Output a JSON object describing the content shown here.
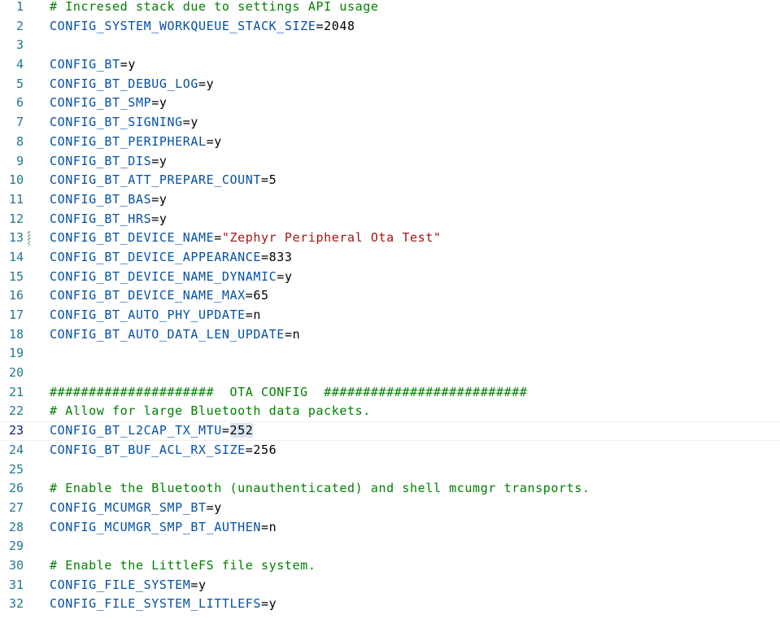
{
  "editor": {
    "current_line": 23,
    "lines": [
      {
        "n": "1",
        "type": "comment",
        "text": "# Incresed stack due to settings API usage"
      },
      {
        "n": "2",
        "type": "kv",
        "key": "CONFIG_SYSTEM_WORKQUEUE_STACK_SIZE",
        "value": "2048"
      },
      {
        "n": "3",
        "type": "blank"
      },
      {
        "n": "4",
        "type": "kv",
        "key": "CONFIG_BT",
        "value": "y"
      },
      {
        "n": "5",
        "type": "kv",
        "key": "CONFIG_BT_DEBUG_LOG",
        "value": "y"
      },
      {
        "n": "6",
        "type": "kv",
        "key": "CONFIG_BT_SMP",
        "value": "y"
      },
      {
        "n": "7",
        "type": "kv",
        "key": "CONFIG_BT_SIGNING",
        "value": "y"
      },
      {
        "n": "8",
        "type": "kv",
        "key": "CONFIG_BT_PERIPHERAL",
        "value": "y"
      },
      {
        "n": "9",
        "type": "kv",
        "key": "CONFIG_BT_DIS",
        "value": "y"
      },
      {
        "n": "10",
        "type": "kv",
        "key": "CONFIG_BT_ATT_PREPARE_COUNT",
        "value": "5"
      },
      {
        "n": "11",
        "type": "kv",
        "key": "CONFIG_BT_BAS",
        "value": "y"
      },
      {
        "n": "12",
        "type": "kv",
        "key": "CONFIG_BT_HRS",
        "value": "y"
      },
      {
        "n": "13",
        "type": "kv",
        "key": "CONFIG_BT_DEVICE_NAME",
        "value": "\"Zephyr Peripheral Ota Test\"",
        "string": true,
        "modified": true
      },
      {
        "n": "14",
        "type": "kv",
        "key": "CONFIG_BT_DEVICE_APPEARANCE",
        "value": "833"
      },
      {
        "n": "15",
        "type": "kv",
        "key": "CONFIG_BT_DEVICE_NAME_DYNAMIC",
        "value": "y"
      },
      {
        "n": "16",
        "type": "kv",
        "key": "CONFIG_BT_DEVICE_NAME_MAX",
        "value": "65"
      },
      {
        "n": "17",
        "type": "kv",
        "key": "CONFIG_BT_AUTO_PHY_UPDATE",
        "value": "n"
      },
      {
        "n": "18",
        "type": "kv",
        "key": "CONFIG_BT_AUTO_DATA_LEN_UPDATE",
        "value": "n"
      },
      {
        "n": "19",
        "type": "blank"
      },
      {
        "n": "20",
        "type": "blank"
      },
      {
        "n": "21",
        "type": "comment",
        "text": "#####################  OTA CONFIG  ##########################"
      },
      {
        "n": "22",
        "type": "comment",
        "text": "# Allow for large Bluetooth data packets."
      },
      {
        "n": "23",
        "type": "kv",
        "key": "CONFIG_BT_L2CAP_TX_MTU",
        "value": "252",
        "selected": true
      },
      {
        "n": "24",
        "type": "kv",
        "key": "CONFIG_BT_BUF_ACL_RX_SIZE",
        "value": "256"
      },
      {
        "n": "25",
        "type": "blank"
      },
      {
        "n": "26",
        "type": "comment",
        "text": "# Enable the Bluetooth (unauthenticated) and shell mcumgr transports."
      },
      {
        "n": "27",
        "type": "kv",
        "key": "CONFIG_MCUMGR_SMP_BT",
        "value": "y"
      },
      {
        "n": "28",
        "type": "kv",
        "key": "CONFIG_MCUMGR_SMP_BT_AUTHEN",
        "value": "n"
      },
      {
        "n": "29",
        "type": "blank"
      },
      {
        "n": "30",
        "type": "comment",
        "text": "# Enable the LittleFS file system."
      },
      {
        "n": "31",
        "type": "kv",
        "key": "CONFIG_FILE_SYSTEM",
        "value": "y"
      },
      {
        "n": "32",
        "type": "kv",
        "key": "CONFIG_FILE_SYSTEM_LITTLEFS",
        "value": "y"
      }
    ]
  }
}
